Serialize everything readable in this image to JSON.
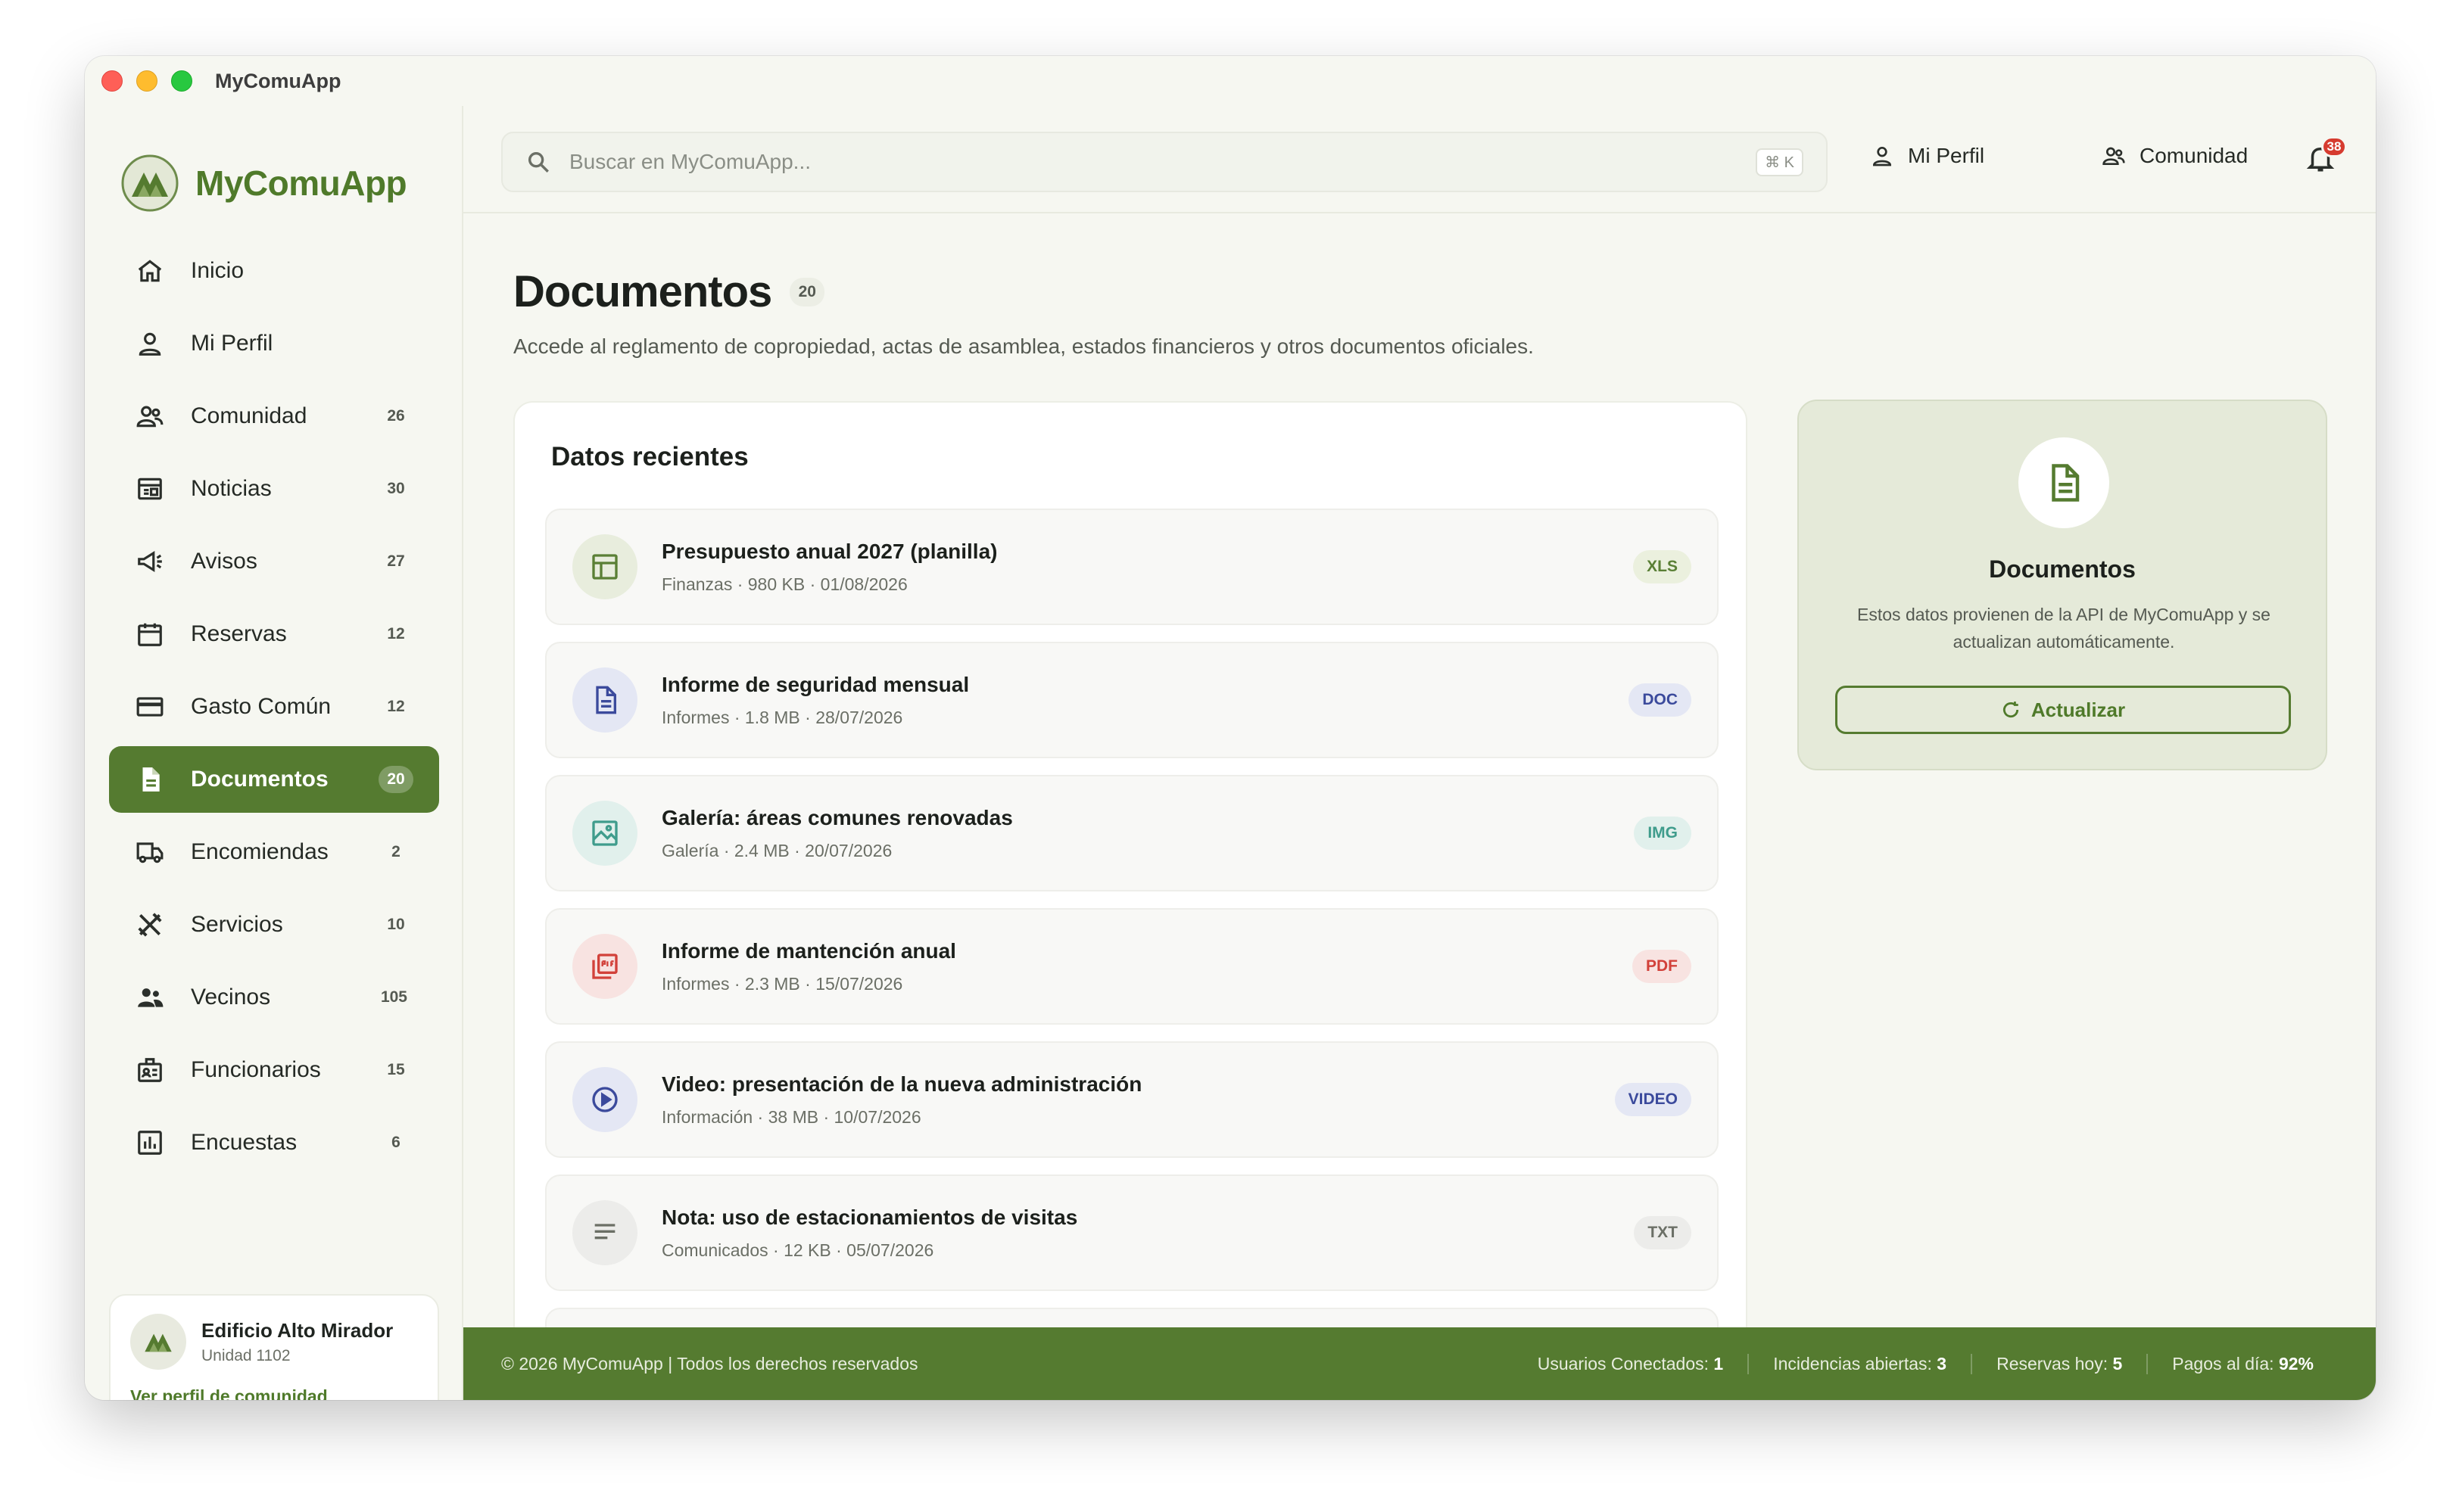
{
  "window": {
    "title": "MyComuApp"
  },
  "brand": {
    "name": "MyComuApp"
  },
  "search": {
    "placeholder": "Buscar en MyComuApp...",
    "shortcut": "⌘ K"
  },
  "topbar": {
    "profile_label": "Mi Perfil",
    "community_label": "Comunidad",
    "notifications_count": "38"
  },
  "sidebar": {
    "items": [
      {
        "label": "Inicio",
        "badge": "",
        "icon": "home-icon"
      },
      {
        "label": "Mi Perfil",
        "badge": "",
        "icon": "user-icon"
      },
      {
        "label": "Comunidad",
        "badge": "26",
        "icon": "group-icon"
      },
      {
        "label": "Noticias",
        "badge": "30",
        "icon": "newspaper-icon"
      },
      {
        "label": "Avisos",
        "badge": "27",
        "icon": "megaphone-icon"
      },
      {
        "label": "Reservas",
        "badge": "12",
        "icon": "calendar-icon"
      },
      {
        "label": "Gasto Común",
        "badge": "12",
        "icon": "credit-card-icon"
      },
      {
        "label": "Documentos",
        "badge": "20",
        "icon": "document-icon"
      },
      {
        "label": "Encomiendas",
        "badge": "2",
        "icon": "truck-icon"
      },
      {
        "label": "Servicios",
        "badge": "10",
        "icon": "tools-icon"
      },
      {
        "label": "Vecinos",
        "badge": "105",
        "icon": "people-icon"
      },
      {
        "label": "Funcionarios",
        "badge": "15",
        "icon": "badge-icon"
      },
      {
        "label": "Encuestas",
        "badge": "6",
        "icon": "bar-chart-icon"
      }
    ],
    "community": {
      "name": "Edificio Alto Mirador",
      "unit": "Unidad 1102",
      "link": "Ver perfil de comunidad"
    }
  },
  "main": {
    "title": "Documentos",
    "count": "20",
    "description": "Accede al reglamento de copropiedad, actas de asamblea, estados financieros y otros documentos oficiales.",
    "recent_title": "Datos recientes",
    "documents": [
      {
        "name": "Presupuesto anual 2027 (planilla)",
        "meta": "Finanzas · 980 KB · 01/08/2026",
        "type": "XLS"
      },
      {
        "name": "Informe de seguridad mensual",
        "meta": "Informes · 1.8 MB · 28/07/2026",
        "type": "DOC"
      },
      {
        "name": "Galería: áreas comunes renovadas",
        "meta": "Galería · 2.4 MB · 20/07/2026",
        "type": "IMG"
      },
      {
        "name": "Informe de mantención anual",
        "meta": "Informes · 2.3 MB · 15/07/2026",
        "type": "PDF"
      },
      {
        "name": "Video: presentación de la nueva administración",
        "meta": "Información · 38 MB · 10/07/2026",
        "type": "VIDEO"
      },
      {
        "name": "Nota: uso de estacionamientos de visitas",
        "meta": "Comunicados · 12 KB · 05/07/2026",
        "type": "TXT"
      },
      {
        "name": "",
        "meta": "",
        "type": ""
      }
    ],
    "info": {
      "title": "Documentos",
      "description": "Estos datos provienen de la API de MyComuApp y se actualizan automáticamente.",
      "button": "Actualizar"
    }
  },
  "footer": {
    "copyright": "© 2026 MyComuApp | Todos los derechos reservados",
    "stats": [
      {
        "label": "Usuarios Conectados:",
        "value": "1"
      },
      {
        "label": "Incidencias abiertas:",
        "value": "3"
      },
      {
        "label": "Reservas hoy:",
        "value": "5"
      },
      {
        "label": "Pagos al día:",
        "value": "92%"
      }
    ]
  },
  "colors": {
    "brand": "#557b30",
    "background": "#f6f7f1",
    "xls": "#5a7f35",
    "doc": "#3b4a9c",
    "img": "#3f9c8c",
    "pdf": "#d2413a",
    "video": "#3b4a9c",
    "txt": "#6b6f66"
  }
}
